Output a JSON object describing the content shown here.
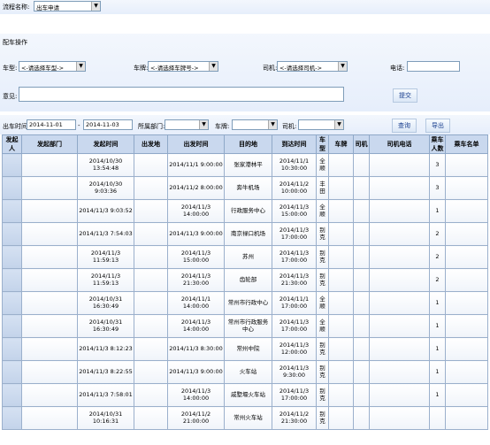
{
  "header": {
    "process_label": "流程名称:",
    "process_value": "出车申请"
  },
  "section": {
    "title": "配车操作"
  },
  "assign": {
    "car_type_label": "车型:",
    "car_type_value": "<-请选择车型->",
    "plate_label": "车牌:",
    "plate_value": "<-请选择车牌号->",
    "driver_label": "司机:",
    "driver_value": "<-请选择司机->",
    "phone_label": "电话:",
    "phone_value": "",
    "opinion_label": "意见:",
    "opinion_value": "",
    "submit_label": "提交"
  },
  "filter": {
    "time_label": "出车时间:",
    "date_from": "2014-11-01",
    "date_sep": "-",
    "date_to": "2014-11-03",
    "dept_label": "所属部门:",
    "dept_value": "",
    "plate_label": "车牌:",
    "plate_value": "",
    "driver_label": "司机:",
    "driver_value": "",
    "query_label": "查询",
    "export_label": "导出"
  },
  "table": {
    "headers": [
      "发起人",
      "发起部门",
      "发起时间",
      "出发地",
      "出发时间",
      "目的地",
      "到达时间",
      "车型",
      "车牌",
      "司机",
      "司机电话",
      "乘车人数",
      "乘车名单"
    ],
    "rows": [
      [
        "",
        "",
        "2014/10/30 13:54:48",
        "",
        "2014/11/1 9:00:00",
        "张家港林平",
        "2014/11/1 10:30:00",
        "全顺",
        "",
        "",
        "",
        "3",
        ""
      ],
      [
        "",
        "",
        "2014/10/30 9:03:36",
        "",
        "2014/11/2 8:00:00",
        "奔牛机场",
        "2014/11/2 10:00:00",
        "丰田",
        "",
        "",
        "",
        "3",
        ""
      ],
      [
        "",
        "",
        "2014/11/3 9:03:52",
        "",
        "2014/11/3 14:00:00",
        "行政服务中心",
        "2014/11/3 15:00:00",
        "全顺",
        "",
        "",
        "",
        "1",
        ""
      ],
      [
        "",
        "",
        "2014/11/3 7:54:03",
        "",
        "2014/11/3 9:00:00",
        "南京禄口机场",
        "2014/11/3 17:00:00",
        "别克",
        "",
        "",
        "",
        "2",
        ""
      ],
      [
        "",
        "",
        "2014/11/3 11:59:13",
        "",
        "2014/11/3 15:00:00",
        "苏州",
        "2014/11/3 17:00:00",
        "别克",
        "",
        "",
        "",
        "2",
        ""
      ],
      [
        "",
        "",
        "2014/11/3 11:59:13",
        "",
        "2014/11/3 21:30:00",
        "齿轮部",
        "2014/11/3 21:30:00",
        "别克",
        "",
        "",
        "",
        "2",
        ""
      ],
      [
        "",
        "",
        "2014/10/31 16:30:49",
        "",
        "2014/11/1 14:00:00",
        "常州市行政中心",
        "2014/11/1 17:00:00",
        "全顺",
        "",
        "",
        "",
        "1",
        ""
      ],
      [
        "",
        "",
        "2014/10/31 16:30:49",
        "",
        "2014/11/3 14:00:00",
        "常州市行政服务中心",
        "2014/11/3 17:00:00",
        "全顺",
        "",
        "",
        "",
        "1",
        ""
      ],
      [
        "",
        "",
        "2014/11/3 8:12:23",
        "",
        "2014/11/3 8:30:00",
        "常州中院",
        "2014/11/3 12:00:00",
        "别克",
        "",
        "",
        "",
        "1",
        ""
      ],
      [
        "",
        "",
        "2014/11/3 8:22:55",
        "",
        "2014/11/3 9:00:00",
        "火车站",
        "2014/11/3 9:30:00",
        "别克",
        "",
        "",
        "",
        "1",
        ""
      ],
      [
        "",
        "",
        "2014/11/3 7:58:01",
        "",
        "2014/11/3 14:00:00",
        "戚墅堰火车站",
        "2014/11/3 17:00:00",
        "别克",
        "",
        "",
        "",
        "1",
        ""
      ],
      [
        "",
        "",
        "2014/10/31 10:16:31",
        "",
        "2014/11/2 21:00:00",
        "常州火车站",
        "2014/11/2 21:30:00",
        "别克",
        "",
        "",
        "",
        "",
        ""
      ]
    ]
  }
}
